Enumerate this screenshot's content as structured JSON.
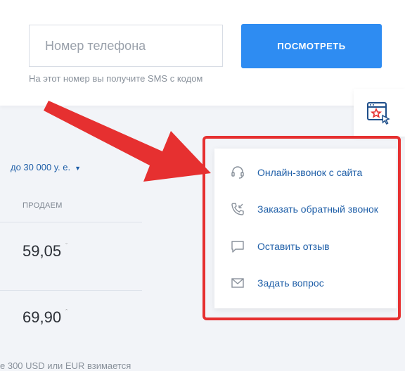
{
  "header": {
    "phone_placeholder": "Номер телефона",
    "hint": "На этот номер вы получите SMS с кодом",
    "view_button": "ПОСМОТРЕТЬ"
  },
  "rates": {
    "amount_filter": "до 30 000 у. е.",
    "column_header": "ПРОДАЕМ",
    "rows": [
      {
        "value": "59,05",
        "trend": "ˇ"
      },
      {
        "value": "69,90",
        "trend": "ˆ"
      }
    ],
    "footnote": "e 300 USD или EUR взимается"
  },
  "contact_menu": {
    "items": [
      {
        "label": "Онлайн-звонок с сайта",
        "icon": "headset-icon"
      },
      {
        "label": "Заказать обратный звонок",
        "icon": "phone-callback-icon"
      },
      {
        "label": "Оставить отзыв",
        "icon": "comment-icon"
      },
      {
        "label": "Задать вопрос",
        "icon": "envelope-icon"
      }
    ]
  },
  "colors": {
    "accent": "#2e8cf2",
    "link": "#1f5fa8",
    "highlight": "#e63030"
  }
}
